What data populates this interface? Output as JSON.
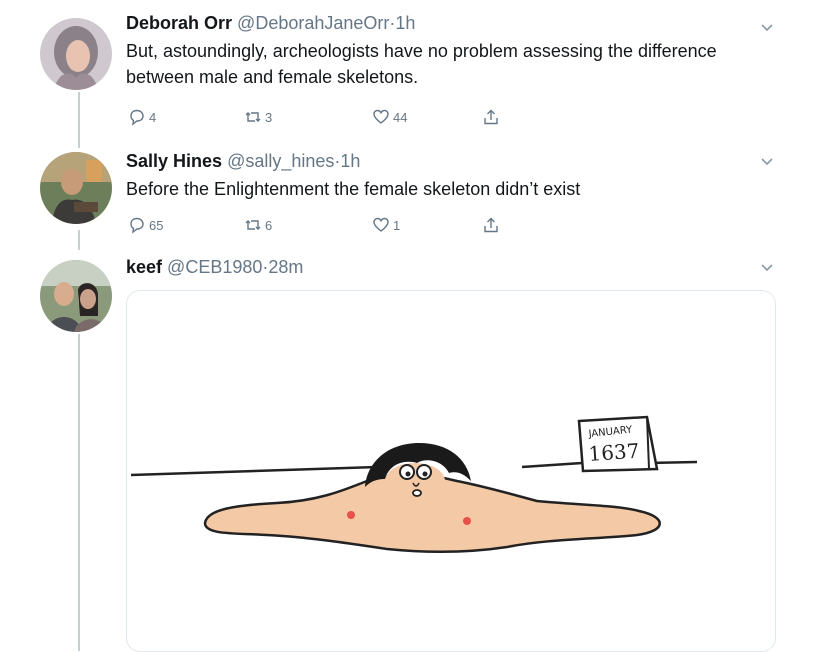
{
  "tweets": [
    {
      "name": "Deborah Orr",
      "handle": "@DeborahJaneOrr",
      "separator": "·",
      "time": "1h",
      "text": "But, astoundingly, archeologists have no problem assessing the difference between male and female skeletons.",
      "replies": "4",
      "retweets": "3",
      "likes": "44"
    },
    {
      "name": "Sally Hines",
      "handle": "@sally_hines",
      "separator": "·",
      "time": "1h",
      "text": "Before the Enlightenment the female skeleton didn’t exist",
      "replies": "65",
      "retweets": "6",
      "likes": "1"
    },
    {
      "name": "keef",
      "handle": "@CEB1980",
      "separator": "·",
      "time": "28m"
    }
  ],
  "cartoon": {
    "calendar_month": "JANUARY",
    "calendar_year": "1637"
  },
  "colors": {
    "secondary_text": "#657786",
    "thread_line": "#c4cfd6",
    "skin": "#f4c9a6"
  }
}
